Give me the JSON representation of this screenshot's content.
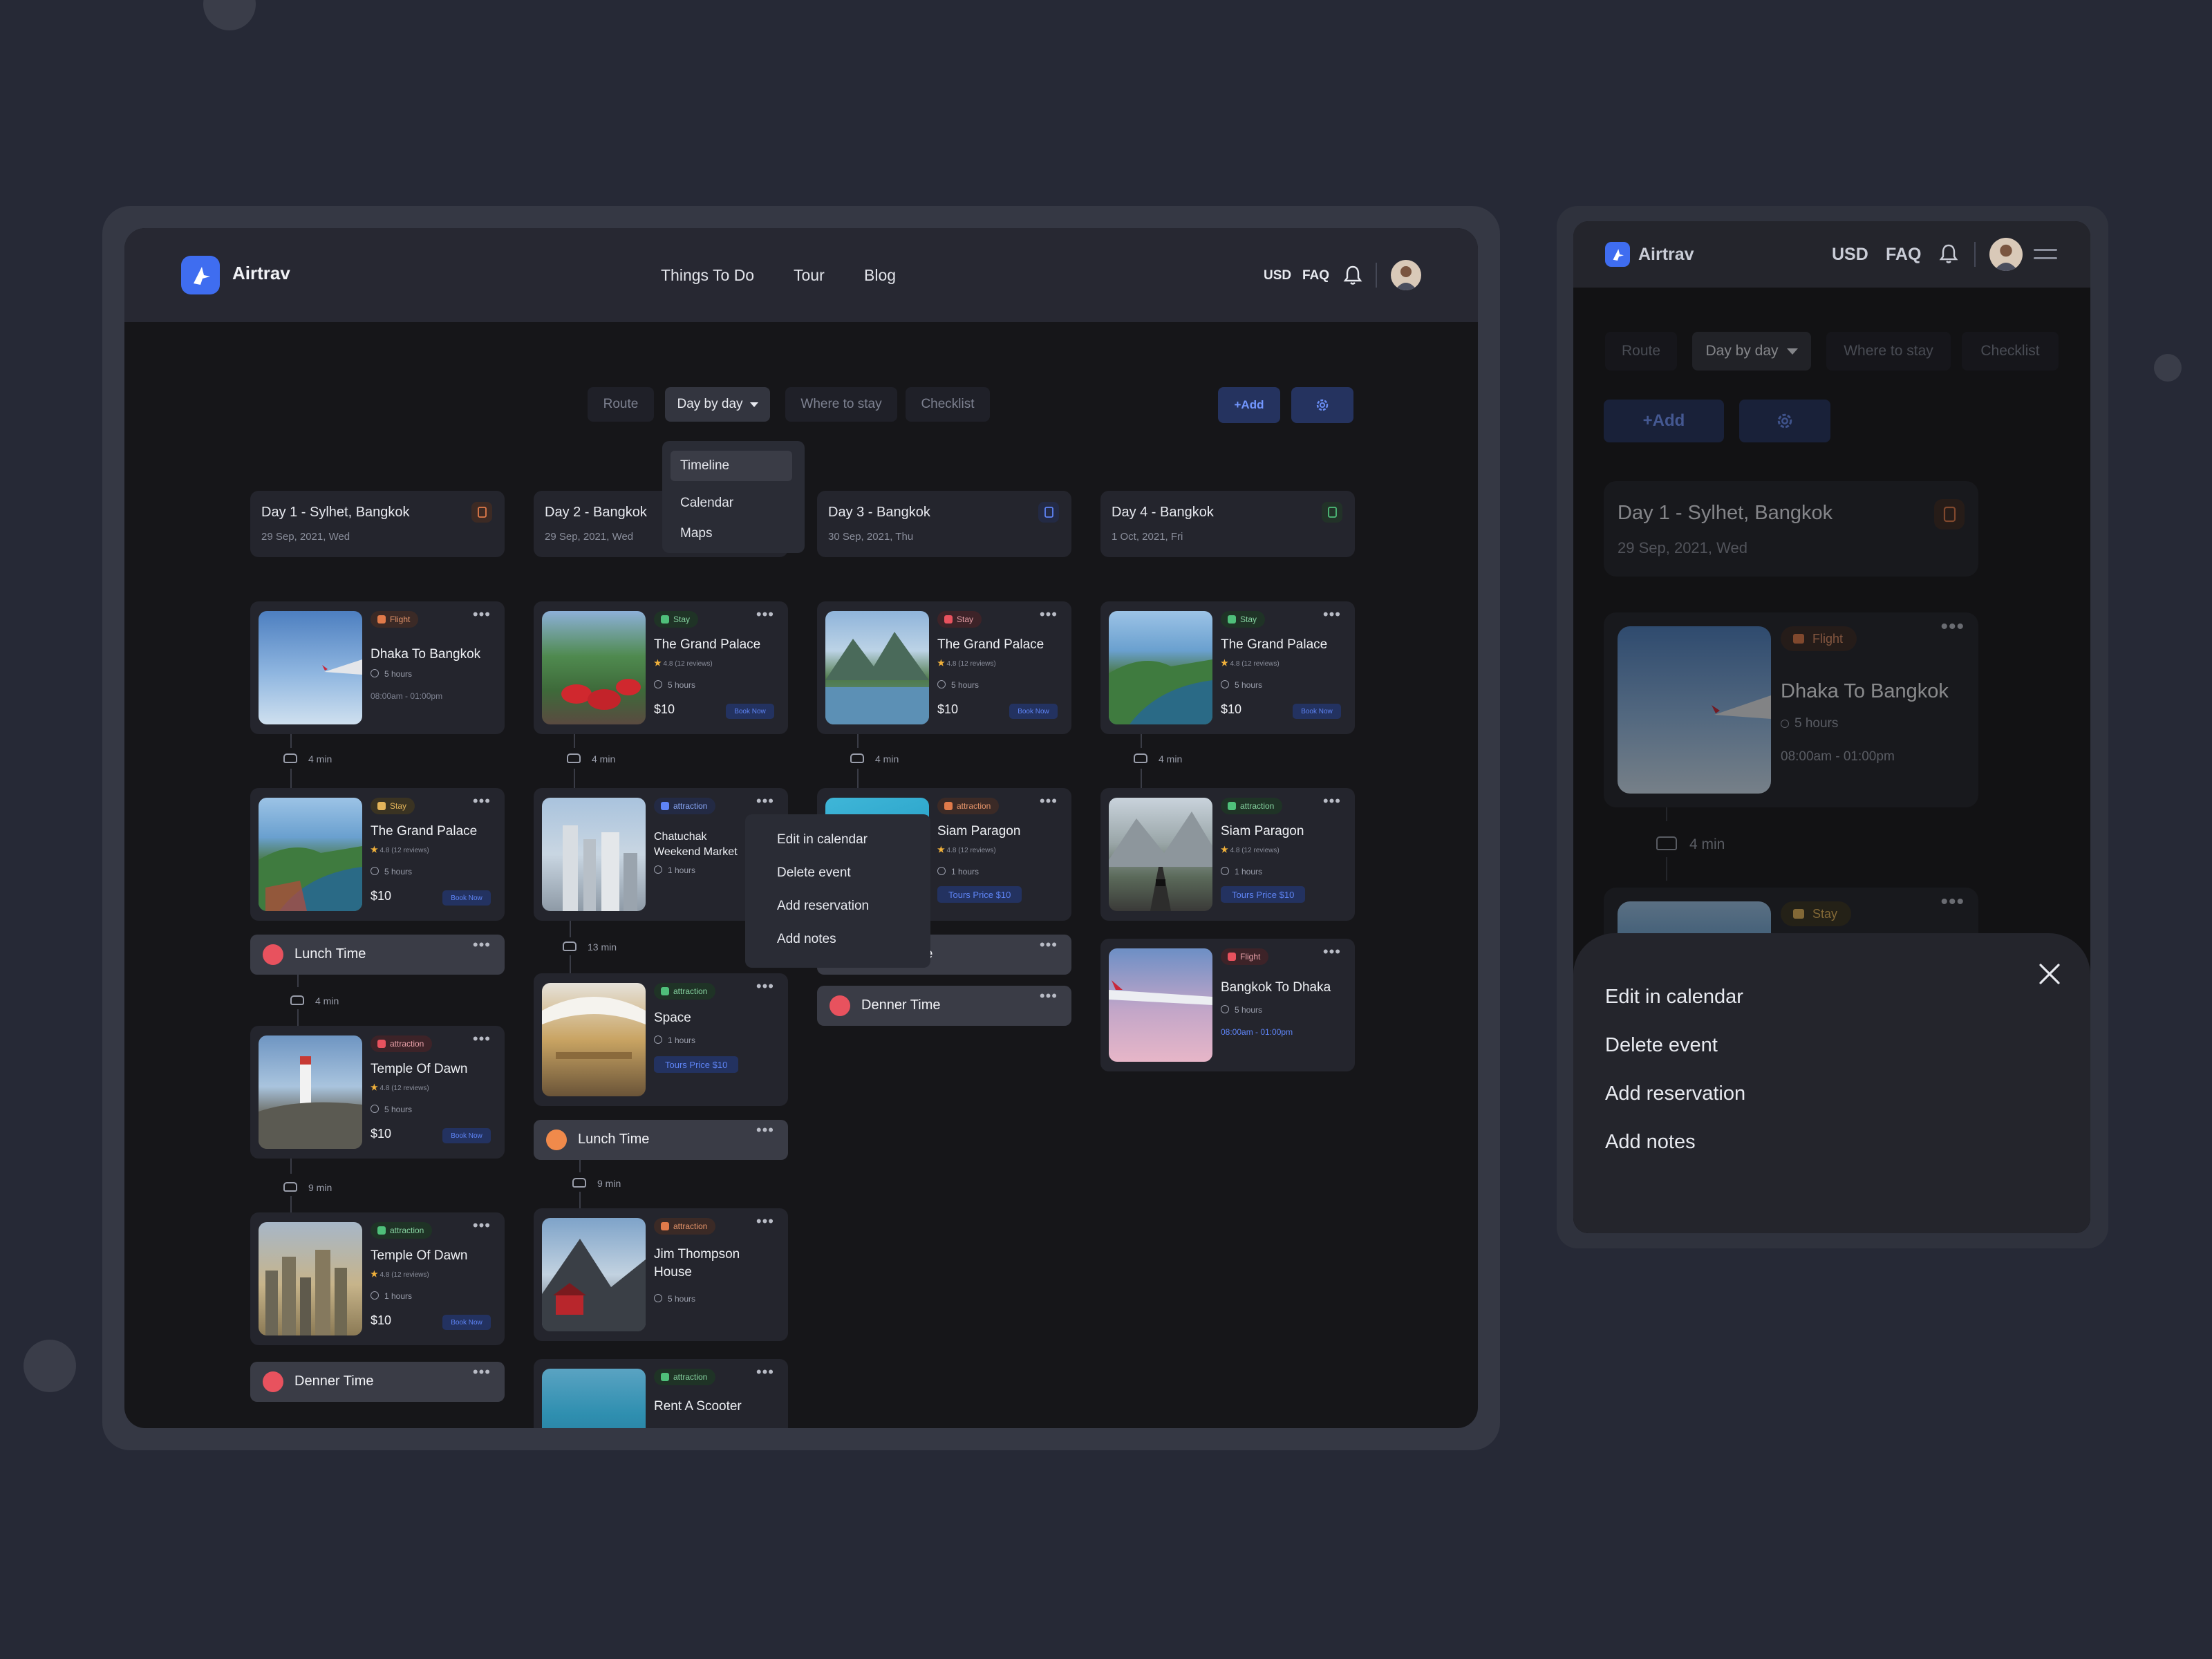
{
  "brand": "Airtrav",
  "nav": {
    "links": [
      "Things To Do",
      "Tour",
      "Blog"
    ],
    "currency": "USD",
    "faq": "FAQ"
  },
  "tabs": {
    "route": "Route",
    "day_by_day": "Day by day",
    "where_to_stay": "Where to stay",
    "checklist": "Checklist"
  },
  "add_button": "+Add",
  "view_dropdown": {
    "items": [
      "Timeline",
      "Calendar",
      "Maps"
    ],
    "selected": "Timeline"
  },
  "days": [
    {
      "title": "Day 1 - Sylhet, Bangkok",
      "date": "29 Sep, 2021, Wed"
    },
    {
      "title": "Day 2 - Bangkok",
      "date": "29 Sep, 2021, Wed"
    },
    {
      "title": "Day 3 - Bangkok",
      "date": "30 Sep, 2021, Thu"
    },
    {
      "title": "Day 4 - Bangkok",
      "date": "1 Oct, 2021, Fri"
    }
  ],
  "badges": {
    "flight": "Flight",
    "stay": "Stay",
    "attraction": "attraction"
  },
  "cards": {
    "dhaka_to_bangkok": {
      "title": "Dhaka To Bangkok",
      "duration": "5 hours",
      "time": "08:00am - 01:00pm"
    },
    "grand_palace": {
      "title": "The Grand Palace",
      "rating": "4.8 (12 reviews)",
      "duration": "5 hours",
      "price": "$10",
      "cta": "Book Now"
    },
    "chatuchak": {
      "title": "Chatuchak Weekend Market",
      "duration": "1 hours"
    },
    "siam_paragon": {
      "title": "Siam Paragon",
      "rating": "4.8 (12 reviews)",
      "duration": "1 hours",
      "tour_price": "Tours Price $10"
    },
    "temple_dawn_5h": {
      "title": "Temple Of Dawn",
      "rating": "4.8 (12 reviews)",
      "duration": "5 hours",
      "price": "$10",
      "cta": "Book Now"
    },
    "temple_dawn_1h": {
      "title": "Temple Of Dawn",
      "rating": "4.8 (12 reviews)",
      "duration": "1 hours",
      "price": "$10",
      "cta": "Book Now"
    },
    "space": {
      "title": "Space",
      "duration": "1 hours",
      "tour_price": "Tours Price $10"
    },
    "jim_thompson": {
      "title": "Jim Thompson House",
      "duration": "5 hours"
    },
    "rent_scooter": {
      "title": "Rent A Scooter"
    },
    "bangkok_to_dhaka": {
      "title": "Bangkok To Dhaka",
      "duration": "5 hours",
      "time": "08:00am - 01:00pm"
    }
  },
  "travel": {
    "t4": "4 min",
    "t13": "13 min",
    "t9": "9 min"
  },
  "meals": {
    "lunch": "Lunch Time",
    "dinner": "Denner Time"
  },
  "context_menu": [
    "Edit in calendar",
    "Delete event",
    "Add reservation",
    "Add notes"
  ],
  "mobile": {
    "day_title": "Day 1 - Sylhet, Bangkok",
    "day_date": "29 Sep, 2021, Wed",
    "card_title": "Dhaka To Bangkok",
    "card_duration": "5 hours",
    "card_time": "08:00am - 01:00pm",
    "travel": "4 min"
  },
  "colors": {
    "accent": "#3f6df0",
    "background": "#262936",
    "surface": "#24252d",
    "meal_icon_red": "#e8525e",
    "meal_icon_orange": "#f08a4b"
  }
}
